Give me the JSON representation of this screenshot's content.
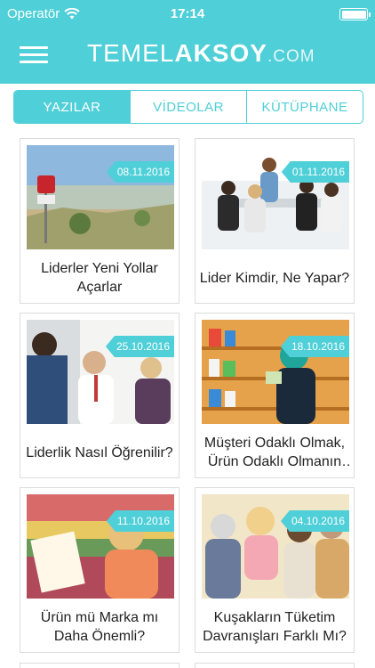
{
  "status_bar": {
    "carrier": "Operatör",
    "time": "17:14"
  },
  "header": {
    "logo_part1": "TEMEL",
    "logo_part2": "AKSOY",
    "logo_part3": ".COM"
  },
  "tabs": [
    {
      "label": "YAZILAR",
      "active": true
    },
    {
      "label": "VİDEOLAR",
      "active": false
    },
    {
      "label": "KÜTÜPHANE",
      "active": false
    }
  ],
  "posts": [
    {
      "date": "08.11.2016",
      "title": "Liderler Yeni Yollar Açarlar"
    },
    {
      "date": "01.11.2016",
      "title": "Lider Kimdir, Ne Yapar?"
    },
    {
      "date": "25.10.2016",
      "title": "Liderlik Nasıl Öğrenilir?"
    },
    {
      "date": "18.10.2016",
      "title": "Müşteri Odaklı Olmak, Ürün Odaklı Olmanın Ötesidir"
    },
    {
      "date": "11.10.2016",
      "title": "Ürün mü Marka mı Daha Önemli?"
    },
    {
      "date": "04.10.2016",
      "title": "Kuşakların Tüketim Davranışları Farklı Mı?"
    }
  ],
  "colors": {
    "accent": "#4fcfd7"
  }
}
